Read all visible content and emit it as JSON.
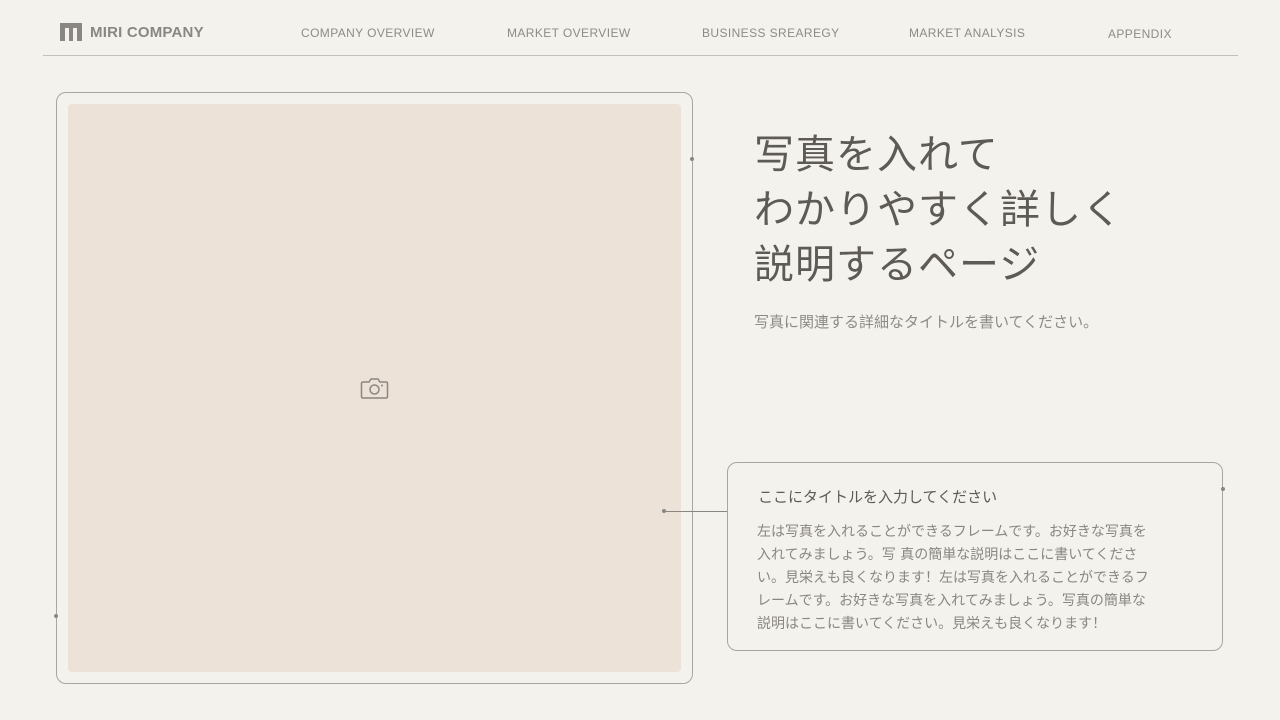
{
  "header": {
    "logo_text": "MIRI COMPANY",
    "logo_icon": "logo-mark-icon",
    "nav": [
      {
        "label": "COMPANY OVERVIEW"
      },
      {
        "label": "MARKET OVERVIEW"
      },
      {
        "label": "BUSINESS SREAREGY"
      },
      {
        "label": "MARKET ANALYSIS"
      },
      {
        "label": "APPENDIX"
      }
    ]
  },
  "photo": {
    "icon": "camera-icon",
    "fill_color": "#ece2d7"
  },
  "main": {
    "title_lines": [
      "写真を入れて",
      "わかりやすく詳しく",
      "説明するページ"
    ],
    "subtitle": "写真に関連する詳細なタイトルを書いてください。"
  },
  "description": {
    "title": "ここにタイトルを入力してください",
    "body_lines": [
      "左は写真を入れることができるフレームです。お好きな写真を",
      "入れてみましょう。写  真の簡単な説明はここに書いてくださ",
      "い。見栄えも良くなります！左は写真を入れることができるフ",
      "レームです。お好きな写真を入れてみましょう。写真の簡単な",
      "説明はここに書いてください。見栄えも良くなります！"
    ]
  },
  "colors": {
    "background": "#f4f2ec",
    "text": "#5e5b57",
    "muted": "#8e8b86"
  }
}
